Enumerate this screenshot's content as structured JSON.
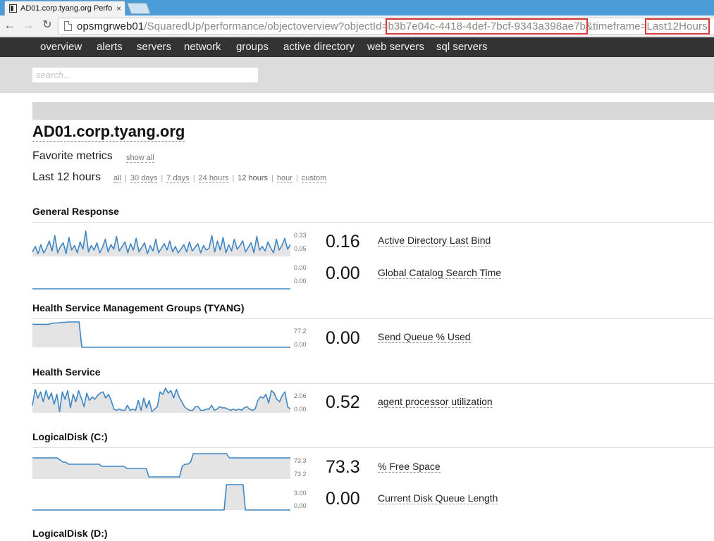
{
  "browser": {
    "tab_title": "AD01.corp.tyang.org Perfo",
    "tab_close": "×",
    "url_host": "opsmgrweb01",
    "url_path": "/SquaredUp/performance/objectoverview?objectId=",
    "url_object_id": "b3b7e04c-4418-4def-7bcf-9343a398ae7b",
    "url_timeframe_key": "&timeframe=",
    "url_timeframe_value": "Last12Hours"
  },
  "nav": {
    "items": [
      "overview",
      "alerts",
      "servers",
      "network",
      "groups",
      "active directory",
      "web servers",
      "sql servers"
    ]
  },
  "search": {
    "placeholder": "search..."
  },
  "page": {
    "title": "AD01.corp.tyang.org",
    "favorites_label": "Favorite metrics",
    "show_all": "show all",
    "range_label": "Last 12 hours",
    "range_options": [
      "all",
      "30 days",
      "7 days",
      "24 hours",
      "12 hours",
      "hour",
      "custom"
    ],
    "active_range": "12 hours"
  },
  "sections": [
    {
      "title": "General Response",
      "metrics": [
        {
          "value": "0.16",
          "name": "Active Directory Last Bind",
          "max_label": "0.33",
          "min_label": "0.05",
          "max": 0.33,
          "min": 0.05,
          "baseline": 0.05,
          "series": [
            0.1,
            0.16,
            0.08,
            0.18,
            0.09,
            0.14,
            0.22,
            0.11,
            0.28,
            0.09,
            0.16,
            0.2,
            0.08,
            0.26,
            0.12,
            0.17,
            0.09,
            0.21,
            0.13,
            0.33,
            0.1,
            0.17,
            0.12,
            0.2,
            0.09,
            0.15,
            0.24,
            0.1,
            0.18,
            0.13,
            0.27,
            0.11,
            0.16,
            0.21,
            0.09,
            0.19,
            0.12,
            0.25,
            0.1,
            0.15,
            0.2,
            0.08,
            0.17,
            0.11,
            0.24,
            0.09,
            0.14,
            0.19,
            0.12,
            0.22,
            0.1,
            0.16,
            0.09,
            0.13,
            0.18,
            0.1,
            0.21,
            0.11,
            0.15,
            0.19,
            0.09,
            0.17,
            0.12,
            0.14,
            0.28,
            0.1,
            0.22,
            0.12,
            0.26,
            0.09,
            0.18,
            0.11,
            0.24,
            0.13,
            0.17,
            0.22,
            0.1,
            0.15,
            0.2,
            0.09,
            0.27,
            0.12,
            0.16,
            0.11,
            0.21,
            0.14,
            0.09,
            0.24,
            0.12,
            0.17,
            0.25,
            0.13,
            0.18
          ]
        },
        {
          "value": "0.00",
          "name": "Global Catalog Search Time",
          "max_label": "0.00",
          "min_label": "0.00",
          "max": 1,
          "min": 0,
          "baseline": 0,
          "series": [
            0,
            0,
            0,
            0,
            0,
            0,
            0,
            0,
            0,
            0
          ]
        }
      ]
    },
    {
      "title": "Health Service Management Groups (TYANG)",
      "metrics": [
        {
          "value": "0.00",
          "name": "Send Queue % Used",
          "max_label": "77.2",
          "min_label": "0.00",
          "max": 77.2,
          "min": 0,
          "baseline": 0,
          "series": [
            70,
            70,
            70,
            70,
            70,
            70,
            70,
            73,
            74,
            74,
            75,
            76,
            76,
            77.2,
            77.2,
            77.2,
            77.2,
            77.2,
            0,
            0,
            0,
            0,
            0,
            0,
            0,
            0,
            0,
            0,
            0,
            0,
            0,
            0,
            0,
            0,
            0,
            0,
            0,
            0,
            0,
            0,
            0,
            0,
            0,
            0,
            0,
            0,
            0,
            0,
            0,
            0,
            0,
            0,
            0,
            0,
            0,
            0,
            0,
            0,
            0,
            0,
            0,
            0,
            0,
            0,
            0,
            0,
            0,
            0,
            0,
            0,
            0,
            0,
            0,
            0,
            0,
            0,
            0,
            0,
            0,
            0,
            0,
            0,
            0,
            0,
            0,
            0,
            0,
            0,
            0,
            0,
            0,
            0,
            0,
            0,
            0
          ]
        }
      ]
    },
    {
      "title": "Health Service",
      "metrics": [
        {
          "value": "0.52",
          "name": "agent processor utilization",
          "max_label": "2.06",
          "min_label": "0.00",
          "max": 2.06,
          "min": 0,
          "baseline": 0,
          "series": [
            0.6,
            1.9,
            1.2,
            1.7,
            0.9,
            1.8,
            1.1,
            1.6,
            0.7,
            1.5,
            0.1,
            1.7,
            1.1,
            1.8,
            0.4,
            1.5,
            0.9,
            1.8,
            1.2,
            0.5,
            1.6,
            1.0,
            1.3,
            1.1,
            1.4,
            1.6,
            1.7,
            1.2,
            1.5,
            1.0,
            0.3,
            0.2,
            0.3,
            0.2,
            0.2,
            0.6,
            0.2,
            0.3,
            0.2,
            1.0,
            0.2,
            1.2,
            0.4,
            1.0,
            0.1,
            0.3,
            0.5,
            1.7,
            1.5,
            2.0,
            1.6,
            1.8,
            1.2,
            1.9,
            1.3,
            0.9,
            0.5,
            0.3,
            0.2,
            0.2,
            0.5,
            0.5,
            0.2,
            0.2,
            0.3,
            0.3,
            0.6,
            0.2,
            0.3,
            0.5,
            0.4,
            0.4,
            0.3,
            0.2,
            0.3,
            0.2,
            0.3,
            0.2,
            0.4,
            0.5,
            0.3,
            0.2,
            0.3,
            1.0,
            1.3,
            1.2,
            1.5,
            0.8,
            1.8,
            1.6,
            1.1,
            0.9,
            1.4,
            1.7,
            0.5,
            0.3
          ]
        }
      ]
    },
    {
      "title": "LogicalDisk (C:)",
      "metrics": [
        {
          "value": "73.3",
          "name": "% Free Space",
          "max_label": "73.3",
          "min_label": "73.2",
          "max": 73.32,
          "min": 73.2,
          "baseline": 73.2,
          "series": [
            73.3,
            73.3,
            73.3,
            73.3,
            73.3,
            73.3,
            73.3,
            73.3,
            73.3,
            73.3,
            73.29,
            73.28,
            73.28,
            73.27,
            73.27,
            73.27,
            73.27,
            73.27,
            73.27,
            73.27,
            73.27,
            73.27,
            73.27,
            73.27,
            73.27,
            73.26,
            73.26,
            73.26,
            73.26,
            73.26,
            73.26,
            73.26,
            73.26,
            73.26,
            73.25,
            73.25,
            73.25,
            73.25,
            73.25,
            73.25,
            73.25,
            73.25,
            73.21,
            73.21,
            73.21,
            73.21,
            73.21,
            73.21,
            73.21,
            73.21,
            73.21,
            73.21,
            73.21,
            73.21,
            73.26,
            73.27,
            73.27,
            73.28,
            73.32,
            73.32,
            73.32,
            73.32,
            73.32,
            73.32,
            73.32,
            73.32,
            73.32,
            73.32,
            73.32,
            73.32,
            73.32,
            73.3,
            73.3,
            73.3,
            73.3,
            73.3,
            73.3,
            73.3,
            73.3,
            73.3,
            73.3,
            73.3,
            73.3,
            73.3,
            73.3,
            73.3,
            73.3,
            73.3,
            73.3,
            73.3,
            73.3,
            73.3,
            73.3,
            73.3
          ]
        },
        {
          "value": "0.00",
          "name": "Current Disk Queue Length",
          "max_label": "3.00",
          "min_label": "0.00",
          "max": 3,
          "min": 0,
          "baseline": 0,
          "series": [
            0,
            0,
            0,
            0,
            0,
            0,
            0,
            0,
            0,
            0,
            0,
            0,
            0,
            0,
            0,
            0,
            0,
            0,
            0,
            0,
            0,
            0,
            0,
            0,
            0,
            0,
            0,
            0,
            0,
            0,
            0,
            0,
            0,
            0,
            0,
            0,
            0,
            0,
            0,
            0,
            0,
            0,
            0,
            0,
            0,
            0,
            0,
            0,
            0,
            0,
            0,
            0,
            0,
            0,
            0,
            0,
            0,
            0,
            0,
            0,
            0,
            0,
            0,
            0,
            0,
            0,
            0,
            0,
            0,
            0,
            0,
            0,
            0,
            0,
            0,
            0,
            0,
            0,
            0,
            0,
            0,
            0,
            3,
            3,
            3,
            3,
            3,
            3,
            3,
            3,
            0,
            0,
            0,
            0,
            0,
            0,
            0,
            0,
            0,
            0,
            0,
            0,
            0,
            0,
            0,
            0,
            0,
            0,
            0,
            0
          ]
        }
      ]
    },
    {
      "title": "LogicalDisk (D:)",
      "metrics": []
    }
  ],
  "colors": {
    "nav_bg": "#333333",
    "spark_line": "#3f86c4",
    "spark_fill": "#e4e4e4",
    "highlight": "#d9383a"
  }
}
